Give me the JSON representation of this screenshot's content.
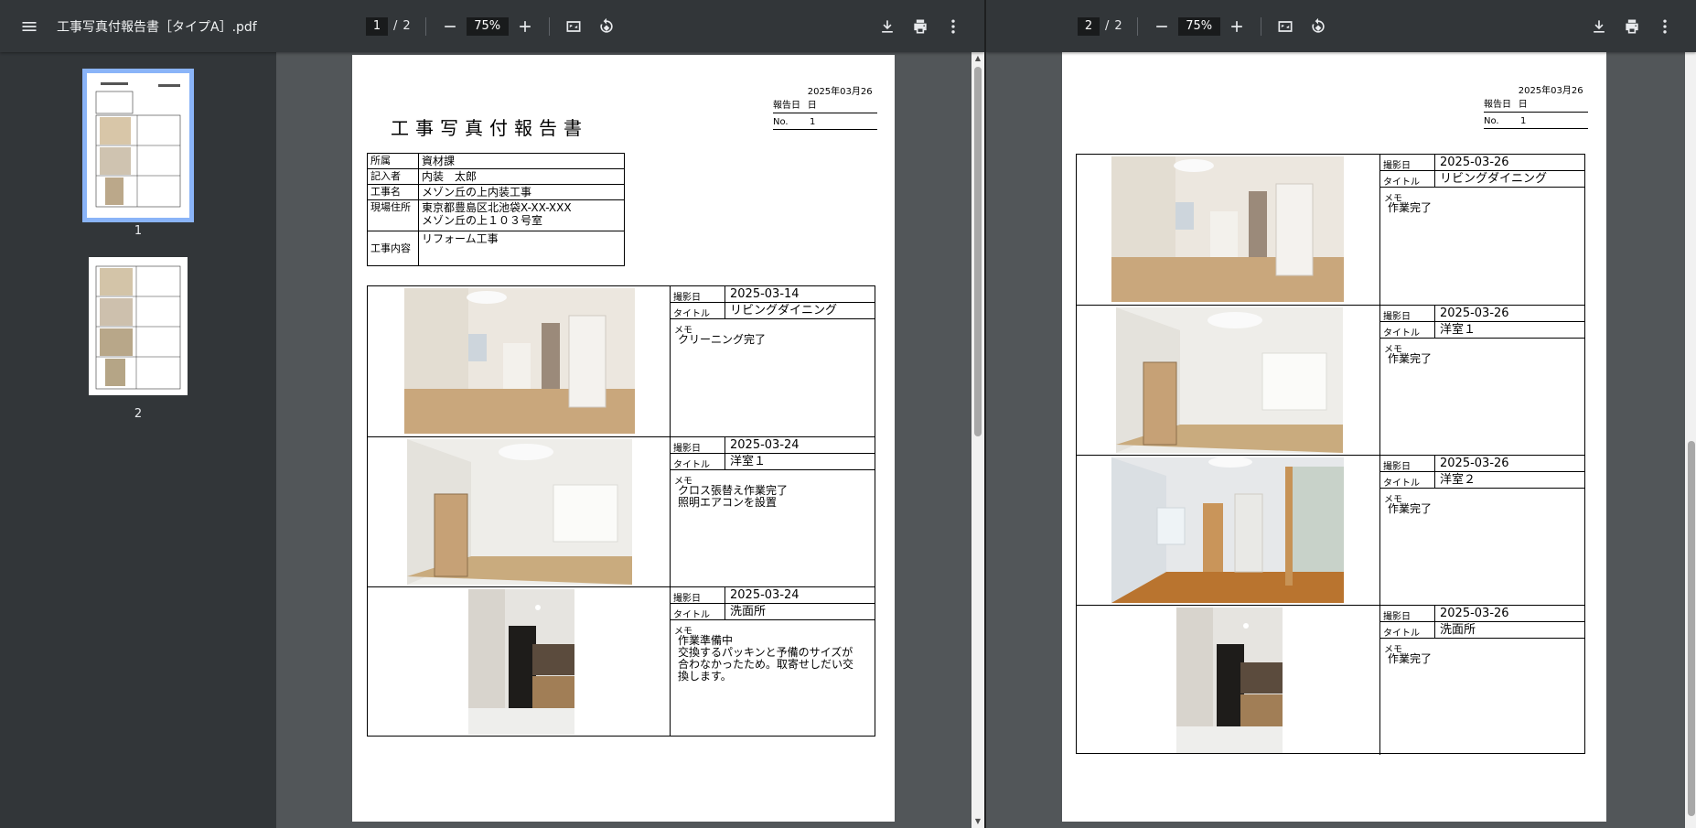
{
  "viewer_left": {
    "filename": "工事写真付報告書［タイプA］.pdf",
    "current_page": "1",
    "total_pages": "2",
    "zoom": "75%",
    "thumb_labels": [
      "1",
      "2"
    ]
  },
  "viewer_right": {
    "current_page": "2",
    "total_pages": "2",
    "zoom": "75%"
  },
  "report": {
    "title": "工事写真付報告書",
    "report_date_label": "報告日",
    "report_date": "2025年03月26日",
    "no_label": "No.",
    "no": "1",
    "info": [
      {
        "key": "所属",
        "value": "資材課"
      },
      {
        "key": "記入者",
        "value": "内装　太郎"
      },
      {
        "key": "工事名",
        "value": "メゾン丘の上内装工事"
      },
      {
        "key": "現場住所",
        "value": "東京都豊島区北池袋X-XX-XXX",
        "value2": "メゾン丘の上１０３号室"
      },
      {
        "key": "工事内容",
        "value": "リフォーム工事"
      }
    ],
    "labels": {
      "date": "撮影日",
      "title": "タイトル",
      "memo": "メモ"
    },
    "page1_photos": [
      {
        "date": "2025-03-14",
        "title": "リビングダイニング",
        "memo": "クリーニング完了"
      },
      {
        "date": "2025-03-24",
        "title": "洋室１",
        "memo": "クロス張替え作業完了\n照明エアコンを設置"
      },
      {
        "date": "2025-03-24",
        "title": "洗面所",
        "memo": "作業準備中\n交換するパッキンと予備のサイズが\n合わなかったため。取寄せしだい交\n換します。"
      }
    ],
    "page2_photos": [
      {
        "date": "2025-03-26",
        "title": "リビングダイニング",
        "memo": "作業完了"
      },
      {
        "date": "2025-03-26",
        "title": "洋室１",
        "memo": "作業完了"
      },
      {
        "date": "2025-03-26",
        "title": "洋室２",
        "memo": "作業完了"
      },
      {
        "date": "2025-03-26",
        "title": "洗面所",
        "memo": "作業完了"
      }
    ]
  },
  "icons": {
    "menu": "menu-icon",
    "minus": "zoom-out-icon",
    "plus": "zoom-in-icon",
    "fit": "fit-page-icon",
    "rotate": "rotate-icon",
    "download": "download-icon",
    "print": "print-icon",
    "more": "more-vert-icon"
  },
  "colors": {
    "toolbar": "#323639",
    "background": "#525659",
    "thumb_selected": "#8ab4f8"
  }
}
